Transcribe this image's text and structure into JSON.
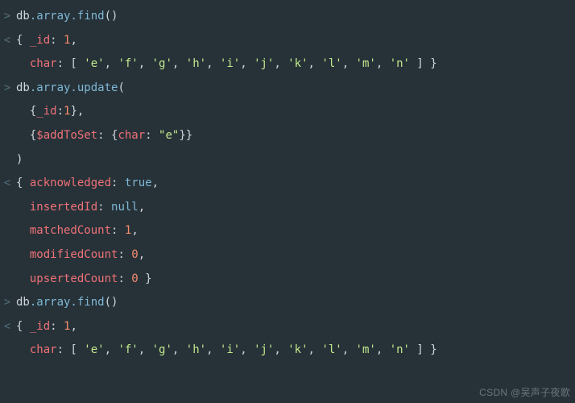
{
  "prompt_in": ">",
  "prompt_out": "<",
  "watermark": "CSDN @吴声子夜歌",
  "lines": [
    {
      "g": "in",
      "seg": [
        {
          "c": "pl",
          "t": "db"
        },
        {
          "c": "fn",
          "t": ".array.find"
        },
        {
          "c": "brc",
          "t": "()"
        }
      ]
    },
    {
      "g": "out",
      "seg": [
        {
          "c": "brc",
          "t": "{ "
        },
        {
          "c": "id",
          "t": "_id"
        },
        {
          "c": "pl",
          "t": ": "
        },
        {
          "c": "num",
          "t": "1"
        },
        {
          "c": "pl",
          "t": ","
        }
      ]
    },
    {
      "g": "",
      "seg": [
        {
          "c": "pl",
          "t": "  "
        },
        {
          "c": "id",
          "t": "char"
        },
        {
          "c": "pl",
          "t": ": [ "
        },
        {
          "c": "str",
          "t": "'e'"
        },
        {
          "c": "pl",
          "t": ", "
        },
        {
          "c": "str",
          "t": "'f'"
        },
        {
          "c": "pl",
          "t": ", "
        },
        {
          "c": "str",
          "t": "'g'"
        },
        {
          "c": "pl",
          "t": ", "
        },
        {
          "c": "str",
          "t": "'h'"
        },
        {
          "c": "pl",
          "t": ", "
        },
        {
          "c": "str",
          "t": "'i'"
        },
        {
          "c": "pl",
          "t": ", "
        },
        {
          "c": "str",
          "t": "'j'"
        },
        {
          "c": "pl",
          "t": ", "
        },
        {
          "c": "str",
          "t": "'k'"
        },
        {
          "c": "pl",
          "t": ", "
        },
        {
          "c": "str",
          "t": "'l'"
        },
        {
          "c": "pl",
          "t": ", "
        },
        {
          "c": "str",
          "t": "'m'"
        },
        {
          "c": "pl",
          "t": ", "
        },
        {
          "c": "str",
          "t": "'n'"
        },
        {
          "c": "pl",
          "t": " ] }"
        }
      ]
    },
    {
      "g": "in",
      "seg": [
        {
          "c": "pl",
          "t": "db"
        },
        {
          "c": "fn",
          "t": ".array.update"
        },
        {
          "c": "brc",
          "t": "("
        }
      ]
    },
    {
      "g": "",
      "seg": [
        {
          "c": "pl",
          "t": "  {"
        },
        {
          "c": "id",
          "t": "_id"
        },
        {
          "c": "pl",
          "t": ":"
        },
        {
          "c": "num",
          "t": "1"
        },
        {
          "c": "pl",
          "t": "},"
        }
      ]
    },
    {
      "g": "",
      "seg": [
        {
          "c": "pl",
          "t": "  {"
        },
        {
          "c": "id",
          "t": "$addToSet"
        },
        {
          "c": "pl",
          "t": ": {"
        },
        {
          "c": "id",
          "t": "char"
        },
        {
          "c": "pl",
          "t": ": "
        },
        {
          "c": "str",
          "t": "\"e\""
        },
        {
          "c": "pl",
          "t": "}}"
        }
      ]
    },
    {
      "g": "",
      "seg": [
        {
          "c": "brc",
          "t": ")"
        }
      ]
    },
    {
      "g": "out",
      "seg": [
        {
          "c": "brc",
          "t": "{ "
        },
        {
          "c": "id",
          "t": "acknowledged"
        },
        {
          "c": "pl",
          "t": ": "
        },
        {
          "c": "bool",
          "t": "true"
        },
        {
          "c": "pl",
          "t": ","
        }
      ]
    },
    {
      "g": "",
      "seg": [
        {
          "c": "pl",
          "t": "  "
        },
        {
          "c": "id",
          "t": "insertedId"
        },
        {
          "c": "pl",
          "t": ": "
        },
        {
          "c": "nul",
          "t": "null"
        },
        {
          "c": "pl",
          "t": ","
        }
      ]
    },
    {
      "g": "",
      "seg": [
        {
          "c": "pl",
          "t": "  "
        },
        {
          "c": "id",
          "t": "matchedCount"
        },
        {
          "c": "pl",
          "t": ": "
        },
        {
          "c": "num",
          "t": "1"
        },
        {
          "c": "pl",
          "t": ","
        }
      ]
    },
    {
      "g": "",
      "seg": [
        {
          "c": "pl",
          "t": "  "
        },
        {
          "c": "id",
          "t": "modifiedCount"
        },
        {
          "c": "pl",
          "t": ": "
        },
        {
          "c": "num",
          "t": "0"
        },
        {
          "c": "pl",
          "t": ","
        }
      ]
    },
    {
      "g": "",
      "seg": [
        {
          "c": "pl",
          "t": "  "
        },
        {
          "c": "id",
          "t": "upsertedCount"
        },
        {
          "c": "pl",
          "t": ": "
        },
        {
          "c": "num",
          "t": "0"
        },
        {
          "c": "pl",
          "t": " }"
        }
      ]
    },
    {
      "g": "in",
      "seg": [
        {
          "c": "pl",
          "t": "db"
        },
        {
          "c": "fn",
          "t": ".array.find"
        },
        {
          "c": "brc",
          "t": "()"
        }
      ]
    },
    {
      "g": "out",
      "seg": [
        {
          "c": "brc",
          "t": "{ "
        },
        {
          "c": "id",
          "t": "_id"
        },
        {
          "c": "pl",
          "t": ": "
        },
        {
          "c": "num",
          "t": "1"
        },
        {
          "c": "pl",
          "t": ","
        }
      ]
    },
    {
      "g": "",
      "seg": [
        {
          "c": "pl",
          "t": "  "
        },
        {
          "c": "id",
          "t": "char"
        },
        {
          "c": "pl",
          "t": ": [ "
        },
        {
          "c": "str",
          "t": "'e'"
        },
        {
          "c": "pl",
          "t": ", "
        },
        {
          "c": "str",
          "t": "'f'"
        },
        {
          "c": "pl",
          "t": ", "
        },
        {
          "c": "str",
          "t": "'g'"
        },
        {
          "c": "pl",
          "t": ", "
        },
        {
          "c": "str",
          "t": "'h'"
        },
        {
          "c": "pl",
          "t": ", "
        },
        {
          "c": "str",
          "t": "'i'"
        },
        {
          "c": "pl",
          "t": ", "
        },
        {
          "c": "str",
          "t": "'j'"
        },
        {
          "c": "pl",
          "t": ", "
        },
        {
          "c": "str",
          "t": "'k'"
        },
        {
          "c": "pl",
          "t": ", "
        },
        {
          "c": "str",
          "t": "'l'"
        },
        {
          "c": "pl",
          "t": ", "
        },
        {
          "c": "str",
          "t": "'m'"
        },
        {
          "c": "pl",
          "t": ", "
        },
        {
          "c": "str",
          "t": "'n'"
        },
        {
          "c": "pl",
          "t": " ] }"
        }
      ]
    }
  ]
}
